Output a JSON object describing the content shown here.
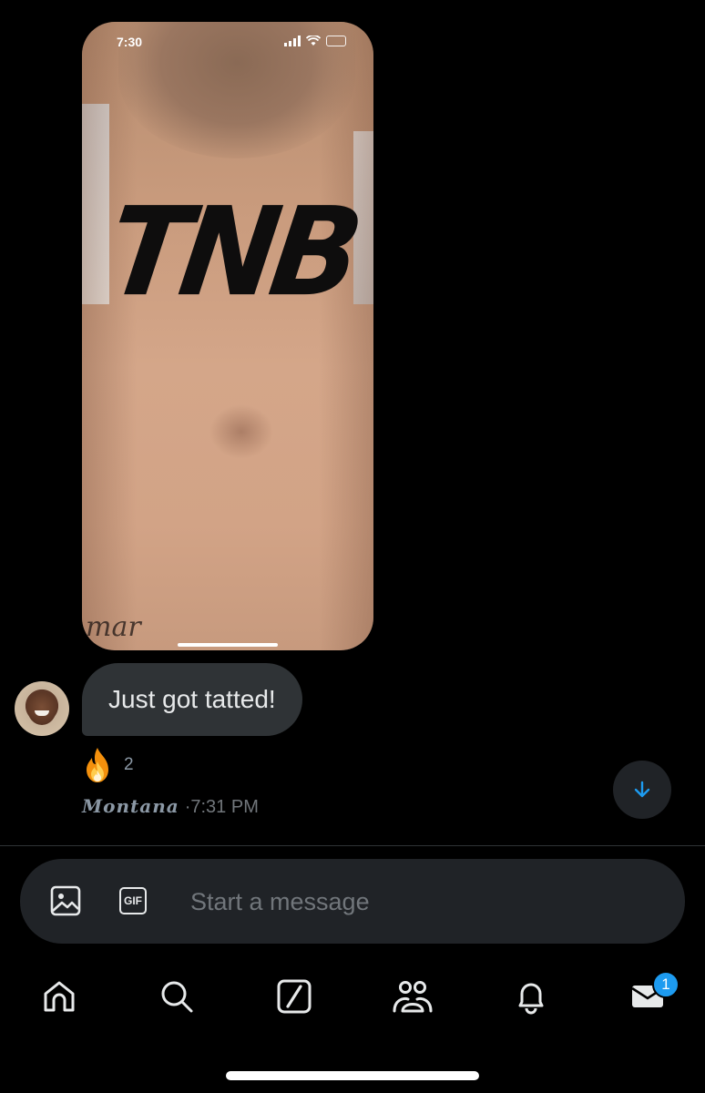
{
  "shared_image": {
    "status_time": "7:30",
    "tattoo_text": "TNB",
    "chest_text": "mar"
  },
  "message": {
    "text": "Just got tatted!",
    "reaction": {
      "emoji": "fire",
      "count": "2"
    },
    "sender": "𝑴𝒐𝒏𝒕𝒂𝒏𝒂",
    "time": "·7:31 PM"
  },
  "composer": {
    "placeholder": "Start a message",
    "gif_label": "GIF"
  },
  "tabbar": {
    "items": [
      "home",
      "search",
      "grok",
      "communities",
      "notifications",
      "messages"
    ],
    "messages_badge": "1"
  },
  "colors": {
    "background": "#000000",
    "bubble": "#2f3336",
    "accent": "#1d9bf0",
    "voice": "#7856ff"
  }
}
